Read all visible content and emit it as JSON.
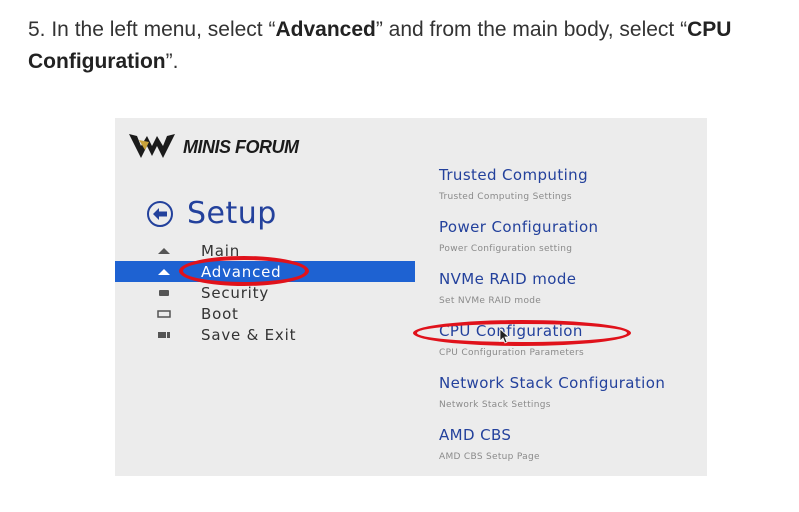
{
  "instruction": {
    "step": "5. In the left menu, select “",
    "bold1": "Advanced",
    "mid": "” and from the main body, select “",
    "bold2": "CPU Configuration",
    "end": "”."
  },
  "bios": {
    "brand": "MINIS FORUM",
    "setup_title": "Setup",
    "menu": [
      {
        "label": "Main",
        "icon": "main-icon"
      },
      {
        "label": "Advanced",
        "icon": "advanced-icon",
        "selected": true
      },
      {
        "label": "Security",
        "icon": "security-icon"
      },
      {
        "label": "Boot",
        "icon": "boot-icon"
      },
      {
        "label": "Save & Exit",
        "icon": "save-exit-icon"
      }
    ],
    "options": [
      {
        "title": "Trusted Computing",
        "subtitle": "Trusted Computing Settings"
      },
      {
        "title": "Power Configuration",
        "subtitle": "Power Configuration setting"
      },
      {
        "title": "NVMe RAID mode",
        "subtitle": "Set NVMe RAID mode"
      },
      {
        "title": "CPU Configuration",
        "subtitle": "CPU Configuration Parameters"
      },
      {
        "title": "Network Stack Configuration",
        "subtitle": "Network Stack Settings"
      },
      {
        "title": "AMD CBS",
        "subtitle": "AMD CBS Setup Page"
      }
    ],
    "colors": {
      "accent": "#23419c",
      "selection": "#1e62d2",
      "annotation": "#e0121b",
      "background": "#ececec"
    }
  }
}
